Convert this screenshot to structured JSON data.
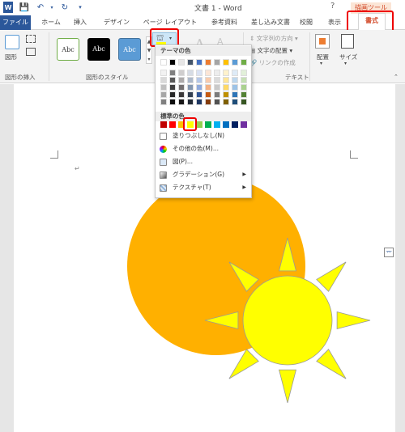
{
  "titlebar": {
    "title": "文書 1 - Word",
    "help": "?",
    "context_label": "描画ツール"
  },
  "tabs": [
    "ファイル",
    "ホーム",
    "挿入",
    "デザイン",
    "ページ レイアウト",
    "参考資料",
    "差し込み文書",
    "校閲",
    "表示",
    "書式"
  ],
  "ribbon": {
    "insert_shapes": {
      "label": "図形の挿入",
      "shapes_button": "図形"
    },
    "shape_styles": {
      "label": "図形のスタイル",
      "styles": [
        "Abc",
        "Abc",
        "Abc"
      ]
    },
    "text": {
      "label": "テキスト",
      "text_direction": "文字列の方向",
      "text_align": "文字の配置",
      "create_link": "リンクの作成"
    },
    "arrange": {
      "label": "配置"
    },
    "size": {
      "label": "サイズ"
    }
  },
  "colorpanel": {
    "theme_header": "テーマの色",
    "standard_header": "標準の色",
    "no_fill": "塗りつぶしなし(N)",
    "more_colors": "その他の色(M)...",
    "picture": "図(P)...",
    "gradient": "グラデーション(G)",
    "texture": "テクスチャ(T)",
    "theme_colors": [
      [
        "#ffffff",
        "#000000",
        "#e7e6e6",
        "#44546a",
        "#4472c4",
        "#ed7d31",
        "#a5a5a5",
        "#ffc000",
        "#5b9bd5",
        "#70ad47"
      ],
      [
        "#f2f2f2",
        "#808080",
        "#d0cece",
        "#d6dce5",
        "#d9e2f3",
        "#fbe5d6",
        "#ededed",
        "#fff2cc",
        "#deebf7",
        "#e2f0d9"
      ],
      [
        "#d9d9d9",
        "#595959",
        "#aeabab",
        "#adb9ca",
        "#b4c7e7",
        "#f8cbad",
        "#dbdbdb",
        "#ffe699",
        "#bdd7ee",
        "#c5e0b4"
      ],
      [
        "#bfbfbf",
        "#404040",
        "#757171",
        "#8497b0",
        "#8faadc",
        "#f4b183",
        "#c9c9c9",
        "#ffd966",
        "#9dc3e6",
        "#a9d18e"
      ],
      [
        "#a6a6a6",
        "#262626",
        "#3b3838",
        "#333f50",
        "#2f5597",
        "#c55a11",
        "#7b7b7b",
        "#bf9000",
        "#2e75b6",
        "#548235"
      ],
      [
        "#808080",
        "#0d0d0d",
        "#171616",
        "#222a35",
        "#1f3864",
        "#843c0c",
        "#525252",
        "#7f6000",
        "#1f4e79",
        "#385723"
      ]
    ],
    "standard_colors": [
      "#c00000",
      "#ff0000",
      "#ffc000",
      "#ffff00",
      "#92d050",
      "#00b050",
      "#00b0f0",
      "#0070c0",
      "#002060",
      "#7030a0"
    ]
  },
  "document": {
    "orange_circle_color": "#ffb000",
    "sun_color": "#ffff00"
  }
}
